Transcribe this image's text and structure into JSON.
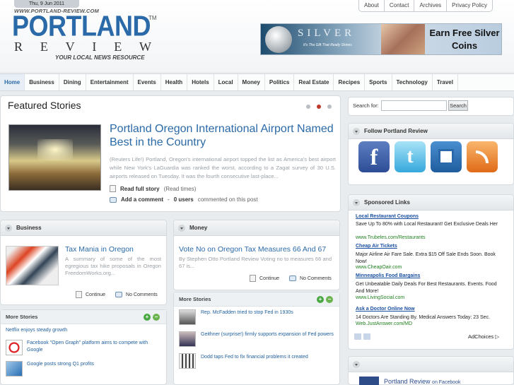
{
  "header": {
    "date": "Thu, 9 Jun 2011",
    "site_url": "WWW.PORTLAND-REVIEW.COM",
    "logo_main": "PORTLAND",
    "logo_tm": "TM",
    "logo_sub_letters": [
      "R",
      "E",
      "V",
      "I",
      "E",
      "W"
    ],
    "tagline": "YOUR LOCAL NEWS RESOURCE",
    "top_links": [
      "About",
      "Contact",
      "Archives",
      "Privacy Policy"
    ],
    "ad": {
      "brand": "SILVER",
      "sub": "It's The Gift That Really Shines",
      "headline": "Earn Free Silver Coins"
    }
  },
  "nav": [
    "Home",
    "Business",
    "Dining",
    "Entertainment",
    "Events",
    "Health",
    "Hotels",
    "Local",
    "Money",
    "Politics",
    "Real Estate",
    "Recipes",
    "Sports",
    "Technology",
    "Travel"
  ],
  "featured": {
    "title": "Featured Stories",
    "headline": "Portland Oregon International Airport Named Best in the Country",
    "summary": "(Reuters Life!) Portland, Oregon's international airport topped the list as America's best airport while New York's LaGuardia was ranked the worst, according to a Zagat survey of 30 U.S. airports released on Tuesday. It was the fourth consecutive last-place...",
    "read_label": "Read full story",
    "read_extra": "(Read times)",
    "comment_label": "Add a comment",
    "comment_count": "0 users",
    "comment_extra": "commented on this post"
  },
  "business": {
    "header": "Business",
    "title": "Tax Mania in Oregon",
    "text": "A summary of some of the most egregious tax hike proposals in Oregon FreedomWorks.org...",
    "continue": "Continue",
    "comments": "No Comments",
    "more_title": "More Stories",
    "more": [
      "Netflix enjoys steady growth",
      "Facebook \"Open Graph\" platform aims to compete with Google",
      "Google posts strong Q1 profits"
    ]
  },
  "money": {
    "header": "Money",
    "title": "Vote No on Oregon Tax Measures 66 And 67",
    "text": "By Stephen Otto Portland Review Voting no to measures 66 and 67 is...",
    "continue": "Continue",
    "comments": "No Comments",
    "more_title": "More Stories",
    "more": [
      "Rep. McFadden tried to stop Fed in 1930s",
      "Geithner (surprise!) firmly supports expansion of Fed powers",
      "Dodd taps Fed to fix financial problems it created"
    ]
  },
  "sidebar": {
    "search_label": "Search for:",
    "search_button": "Search",
    "follow_title": "Follow Portland Review",
    "social": [
      "facebook-icon",
      "twitter-icon",
      "delicious-icon",
      "rss-icon"
    ],
    "sponsored_title": "Sponsored Links",
    "ads": [
      {
        "title": "Local Restaurant Coupons",
        "text": "Save Up To 80% with Local Restaurant! Get Exclusive Deals Her",
        "url": "www.Trubeles.com/Restaurants"
      },
      {
        "title": "Cheap Air Tickets",
        "text": "Major Airline Air Fare Sale. Extra $15 Off Sale Ends Soon. Book Now!",
        "url": "www.CheapOair.com"
      },
      {
        "title": "Minneapolis Food Bargains",
        "text": "Get Unbeatable Daily Deals For Best Restaurants. Events. Food And More!",
        "url": "www.LivingSocial.com"
      },
      {
        "title": "Ask a Doctor Online Now",
        "text": "14 Doctors Are Standing By. Medical Answers Today: 23 Sec.",
        "url": "Web.JustAnswer.com/MD"
      }
    ],
    "adchoices": "AdChoices ▷",
    "fb_name": "Portland Review",
    "fb_suffix": "on Facebook"
  }
}
